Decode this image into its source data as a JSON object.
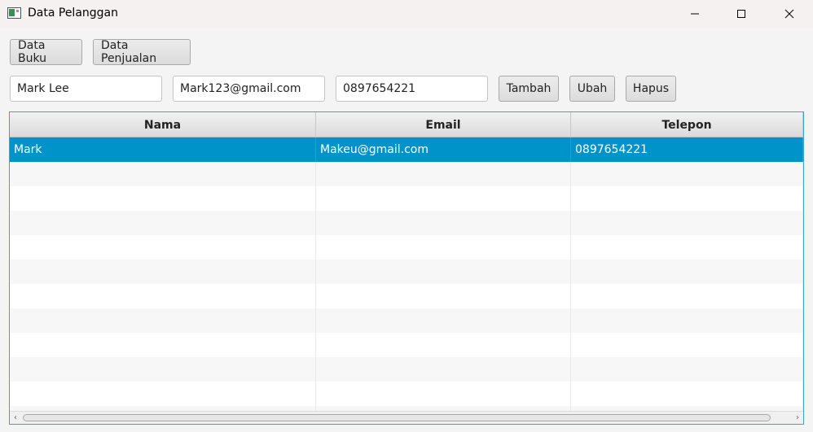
{
  "window": {
    "title": "Data Pelanggan",
    "icon": "app-window-icon"
  },
  "nav": {
    "data_buku_label": "Data Buku",
    "data_penjualan_label": "Data Penjualan"
  },
  "form": {
    "nama_value": "Mark Lee",
    "email_value": "Mark123@gmail.com",
    "telepon_value": "0897654221",
    "tambah_label": "Tambah",
    "ubah_label": "Ubah",
    "hapus_label": "Hapus"
  },
  "table": {
    "columns": [
      "Nama",
      "Email",
      "Telepon"
    ],
    "rows": [
      {
        "nama": "Mark",
        "email": "Makeu@gmail.com",
        "telepon": "0897654221",
        "selected": true
      }
    ],
    "selection_color": "#0093c9",
    "border_color": "#3ea0d8"
  }
}
